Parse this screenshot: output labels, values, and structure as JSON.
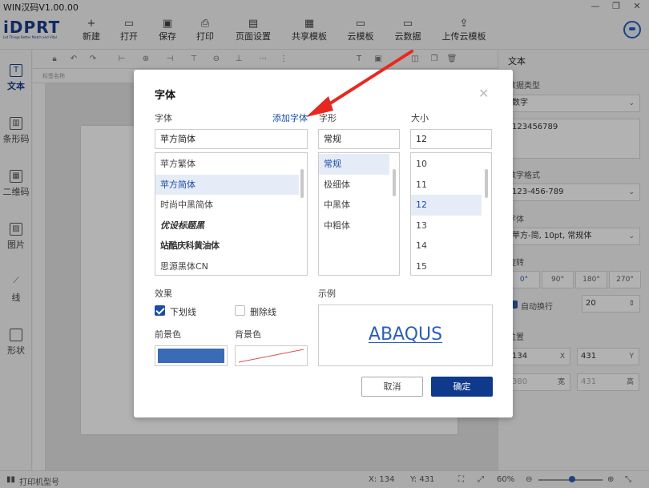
{
  "window": {
    "title": "WIN汉码V1.00.00",
    "controls": [
      "—",
      "❐",
      "✕"
    ]
  },
  "logo": {
    "text": "iDPRT",
    "tagline": "Let Things Better Match and Vital"
  },
  "toolbar": {
    "items": [
      {
        "label": "新建",
        "icon": "+"
      },
      {
        "label": "打开",
        "icon": "▭"
      },
      {
        "label": "保存",
        "icon": "▣"
      },
      {
        "label": "打印",
        "icon": "⎙"
      },
      {
        "label": "页面设置",
        "icon": "▤"
      },
      {
        "label": "共享模板",
        "icon": "▦"
      },
      {
        "label": "云模板",
        "icon": "▭"
      },
      {
        "label": "云数据",
        "icon": "▭"
      },
      {
        "label": "上传云模板",
        "icon": "⇪"
      }
    ]
  },
  "sidebar": {
    "items": [
      {
        "label": "文本",
        "icon": "T",
        "active": true
      },
      {
        "label": "条形码",
        "icon": "▥"
      },
      {
        "label": "二维码",
        "icon": "▦"
      },
      {
        "label": "图片",
        "icon": "▨"
      },
      {
        "label": "线",
        "icon": "⟋"
      },
      {
        "label": "形状",
        "icon": ""
      }
    ]
  },
  "canvas": {
    "ruler_label": "标签名称"
  },
  "right_panel": {
    "title": "文本",
    "data_type_label": "数据类型",
    "data_type_value": "数字",
    "content_value": "123456789",
    "format_label": "数字格式",
    "format_value": "123-456-789",
    "font_label": "字体",
    "font_value": "苹方-简, 10pt, 常规体",
    "rotate_label": "旋转",
    "rotate_options": [
      "0°",
      "90°",
      "180°",
      "270°"
    ],
    "autowrap_label": "自动换行",
    "autowrap_value": "20",
    "position_label": "位置",
    "x_value": "134",
    "x_unit": "X",
    "y_value": "431",
    "y_unit": "Y",
    "w_value": "380",
    "w_unit": "宽",
    "h_value": "431",
    "h_unit": "高"
  },
  "statusbar": {
    "printer_label": "打印机型号",
    "x_text": "X:  134",
    "y_text": "Y:  431",
    "zoom": "60%"
  },
  "dialog": {
    "title": "字体",
    "font_label": "字体",
    "add_font_link": "添加字体",
    "style_label": "字形",
    "size_label": "大小",
    "font_value": "苹方简体",
    "style_value": "常规",
    "size_value": "12",
    "fonts": [
      "苹方繁体",
      "苹方简体",
      "时尚中黑简体",
      "优设标题黑",
      "站酷庆科黄油体",
      "思源黑体CN"
    ],
    "selected_font_index": 1,
    "styles": [
      "常规",
      "极细体",
      "中黑体",
      "中粗体"
    ],
    "selected_style_index": 0,
    "sizes": [
      "10",
      "11",
      "12",
      "13",
      "14",
      "15"
    ],
    "selected_size_index": 2,
    "effects_label": "效果",
    "underline_label": "下划线",
    "underline_checked": true,
    "strike_label": "删除线",
    "strike_checked": false,
    "fg_label": "前景色",
    "bg_label": "背景色",
    "fg_color": "#3a6bb5",
    "sample_label": "示例",
    "sample_text": "ABAQUS",
    "cancel_label": "取消",
    "ok_label": "确定"
  },
  "annotation": {
    "arrow_color": "#e8281e"
  }
}
